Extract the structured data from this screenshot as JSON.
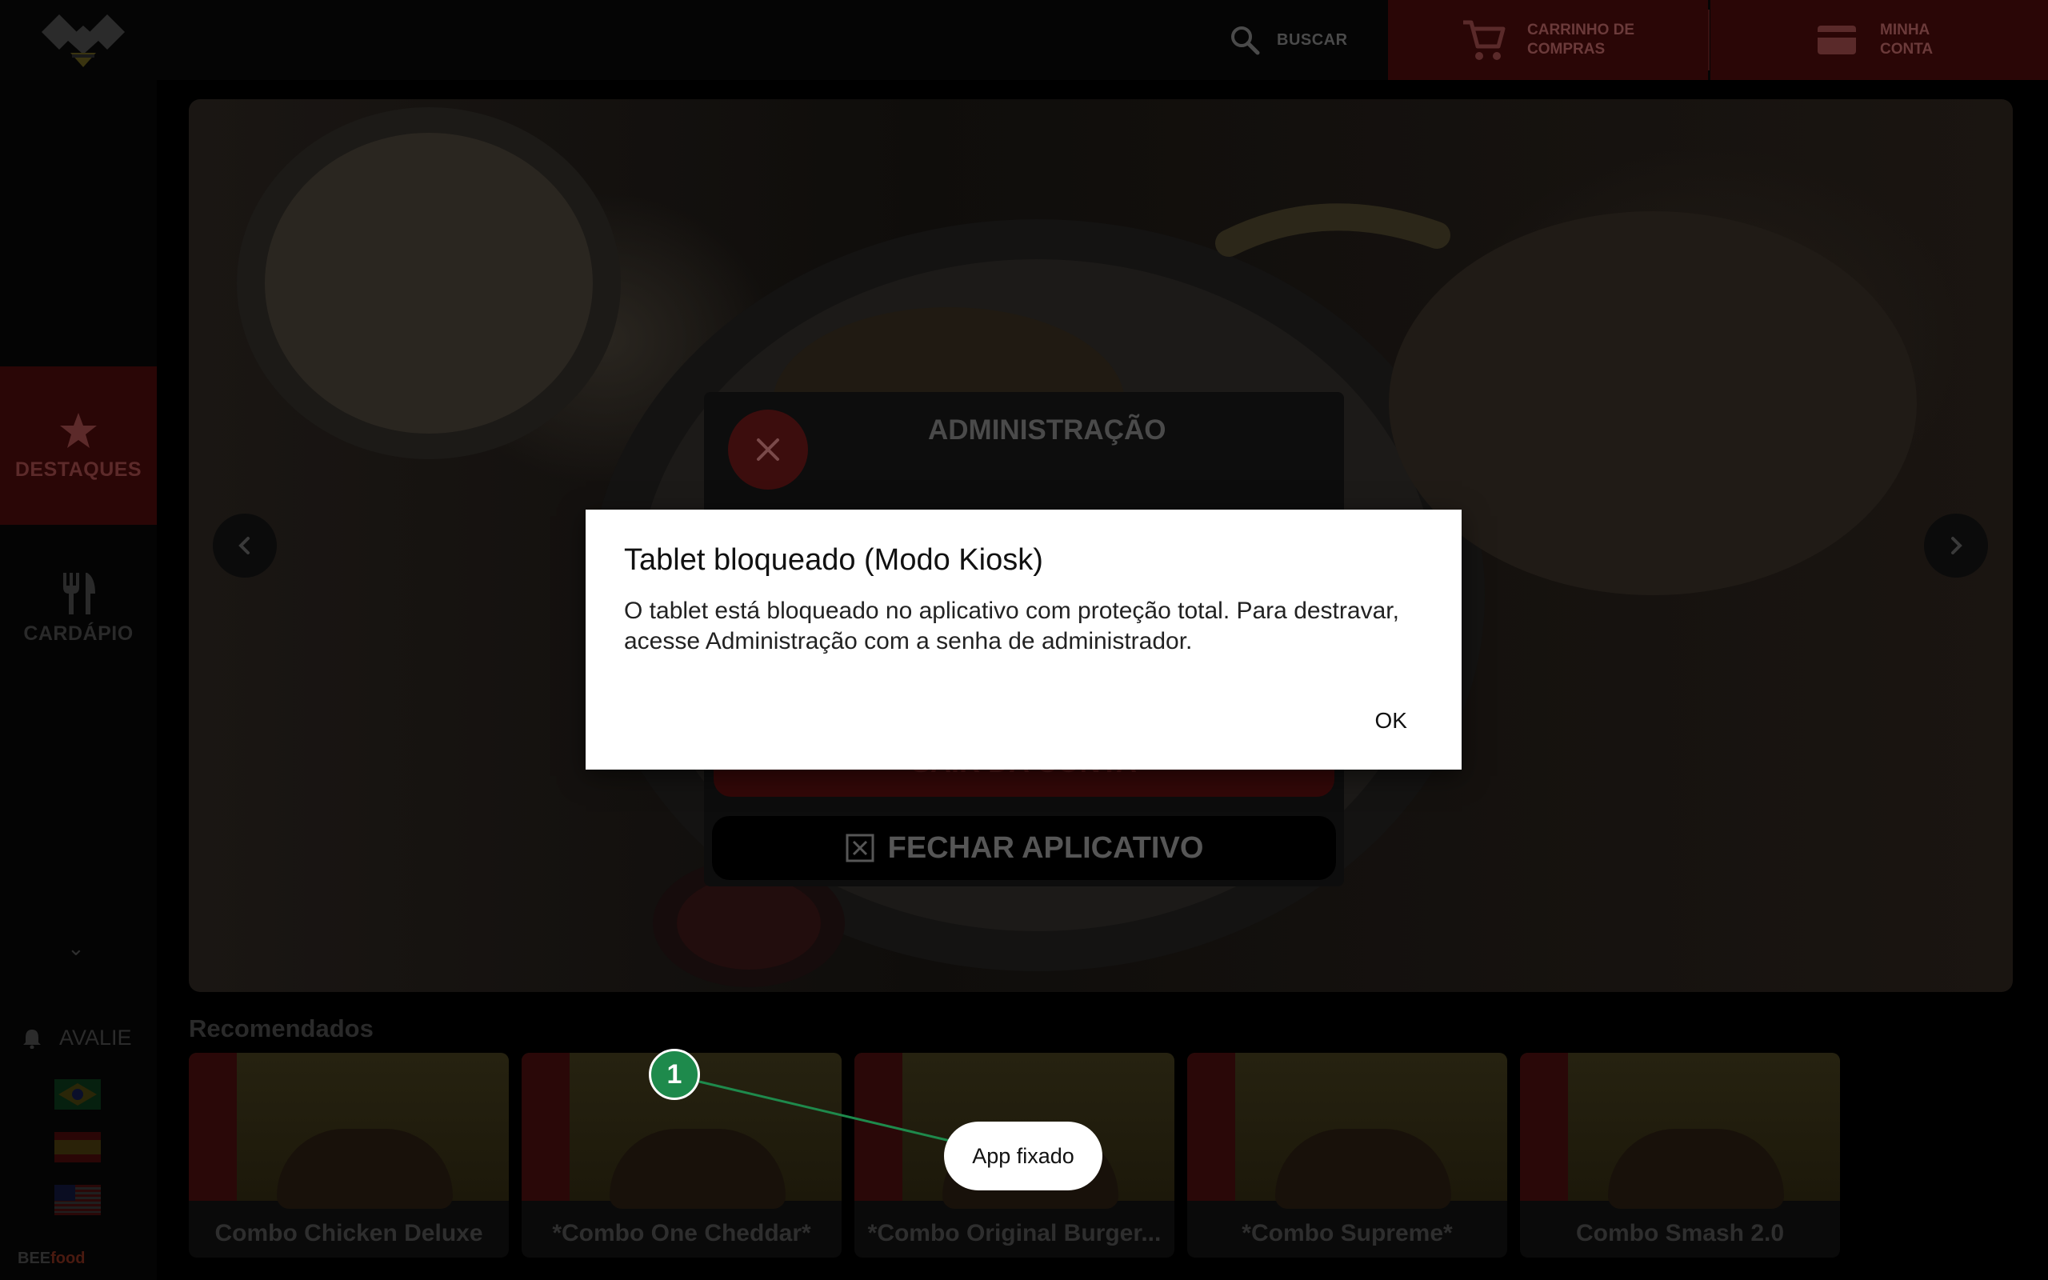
{
  "header": {
    "search_label": "BUSCAR",
    "cart_label": "CARRINHO DE\nCOMPRAS",
    "account_label": "MINHA\nCONTA"
  },
  "sidebar": {
    "items": [
      {
        "label": "DESTAQUES",
        "icon": "star-icon",
        "active": true
      },
      {
        "label": "CARDÁPIO",
        "icon": "fork-knife-icon",
        "active": false
      }
    ],
    "avalie_label": "AVALIE",
    "flags": [
      "brazil-flag",
      "spain-flag",
      "usa-flag"
    ],
    "brand_bee": "BEE",
    "brand_food": "food"
  },
  "recommended": {
    "title": "Recomendados",
    "items": [
      {
        "name": "Combo Chicken Deluxe"
      },
      {
        "name": "*Combo One Cheddar*"
      },
      {
        "name": "*Combo Original Burger..."
      },
      {
        "name": "*Combo Supreme*"
      },
      {
        "name": "Combo Smash 2.0"
      }
    ]
  },
  "admin": {
    "title": "ADMINISTRAÇÃO",
    "logout_label": "SAIR DA CONTA",
    "close_app_label": "FECHAR APLICATIVO"
  },
  "dialog": {
    "title": "Tablet bloqueado (Modo Kiosk)",
    "message": "O tablet está bloqueado no aplicativo com proteção total. Para destravar, acesse Administração com a senha de administrador.",
    "ok_label": "OK"
  },
  "annotation": {
    "step_number": "1",
    "pill_label": "App fixado"
  },
  "colors": {
    "accent_red": "#8b1a1a",
    "annotation_green": "#1e8a4c"
  }
}
